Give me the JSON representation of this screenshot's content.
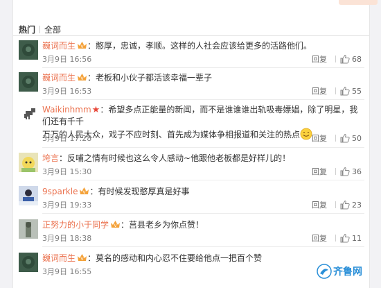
{
  "tabs": {
    "hot": "热门",
    "all": "全部"
  },
  "reply_label": "回复",
  "colors": {
    "name": "#eb7350",
    "accent": "#fa7d3c"
  },
  "comments": [
    {
      "user": "巍词而生",
      "vip": true,
      "text": "：憨厚，忠诚，孝顺。这样的人社会应该给更多的活路他们。",
      "date": "3月9日 16:56",
      "likes": "68"
    },
    {
      "user": "巍词而生",
      "vip": true,
      "text": "：老板和小伙子都活该幸福一辈子",
      "date": "3月9日 16:53",
      "likes": "55"
    },
    {
      "user": "Waikinhmm",
      "vip": false,
      "star": "★",
      "text_line1": "：希望多点正能量的新闻，而不是谁谁谁出轨吸毒嫖娼，除了明星，我们还有千千",
      "text_line2": "万万的人民大众，戏子不应时刻、首先成为媒体争相报道和关注的热点",
      "date": "3月9日 17:28",
      "likes": "50"
    },
    {
      "user": "垮言",
      "vip": false,
      "text": "：反哺之情有时候也这么令人感动~他跟他老板都是好样儿的！",
      "date": "3月9日 15:30",
      "likes": "36"
    },
    {
      "user": "9sparkle",
      "vip": true,
      "text": "：有时候发现憨厚真是好事",
      "date": "3月9日 19:33",
      "likes": "23"
    },
    {
      "user": "正努力的小于同学",
      "vip": true,
      "text": "：莒县老乡为你点赞！",
      "date": "3月9日 18:38",
      "likes": "11"
    },
    {
      "user": "巍词而生",
      "vip": true,
      "text": "：莫名的感动和内心忍不住要给他点一把百个赞",
      "date": "3月9日 16:55",
      "likes": ""
    }
  ],
  "watermark": {
    "text": "齐鲁网"
  }
}
